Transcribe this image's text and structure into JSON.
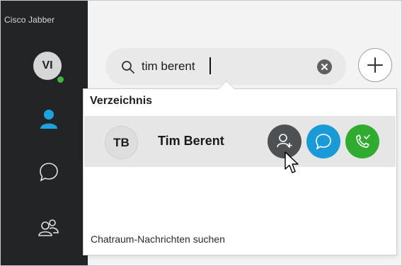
{
  "app": {
    "title": "Cisco Jabber"
  },
  "user": {
    "initials": "VI",
    "presence": "available",
    "presence_color": "#41b53f"
  },
  "sidebar": {
    "items": [
      {
        "name": "contacts",
        "icon": "person-icon",
        "active": true,
        "color": "#1aa3e0"
      },
      {
        "name": "chats",
        "icon": "chat-bubble-icon",
        "active": false
      },
      {
        "name": "meetings",
        "icon": "group-icon",
        "active": false
      }
    ]
  },
  "search": {
    "value": "tim berent",
    "icon": "search-icon",
    "clear_icon": "clear-circle-icon"
  },
  "toolbar": {
    "add_icon": "plus-icon"
  },
  "dropdown": {
    "section_title": "Verzeichnis",
    "results": [
      {
        "initials": "TB",
        "name": "Tim Berent",
        "actions": [
          {
            "name": "add-contact",
            "icon": "add-person-icon",
            "color": "#4e5154"
          },
          {
            "name": "chat",
            "icon": "chat-bubble-icon",
            "color": "#1a9bd7"
          },
          {
            "name": "call",
            "icon": "phone-icon",
            "color": "#2fac2f"
          }
        ]
      }
    ],
    "footer_link": "Chatraum-Nachrichten suchen"
  }
}
